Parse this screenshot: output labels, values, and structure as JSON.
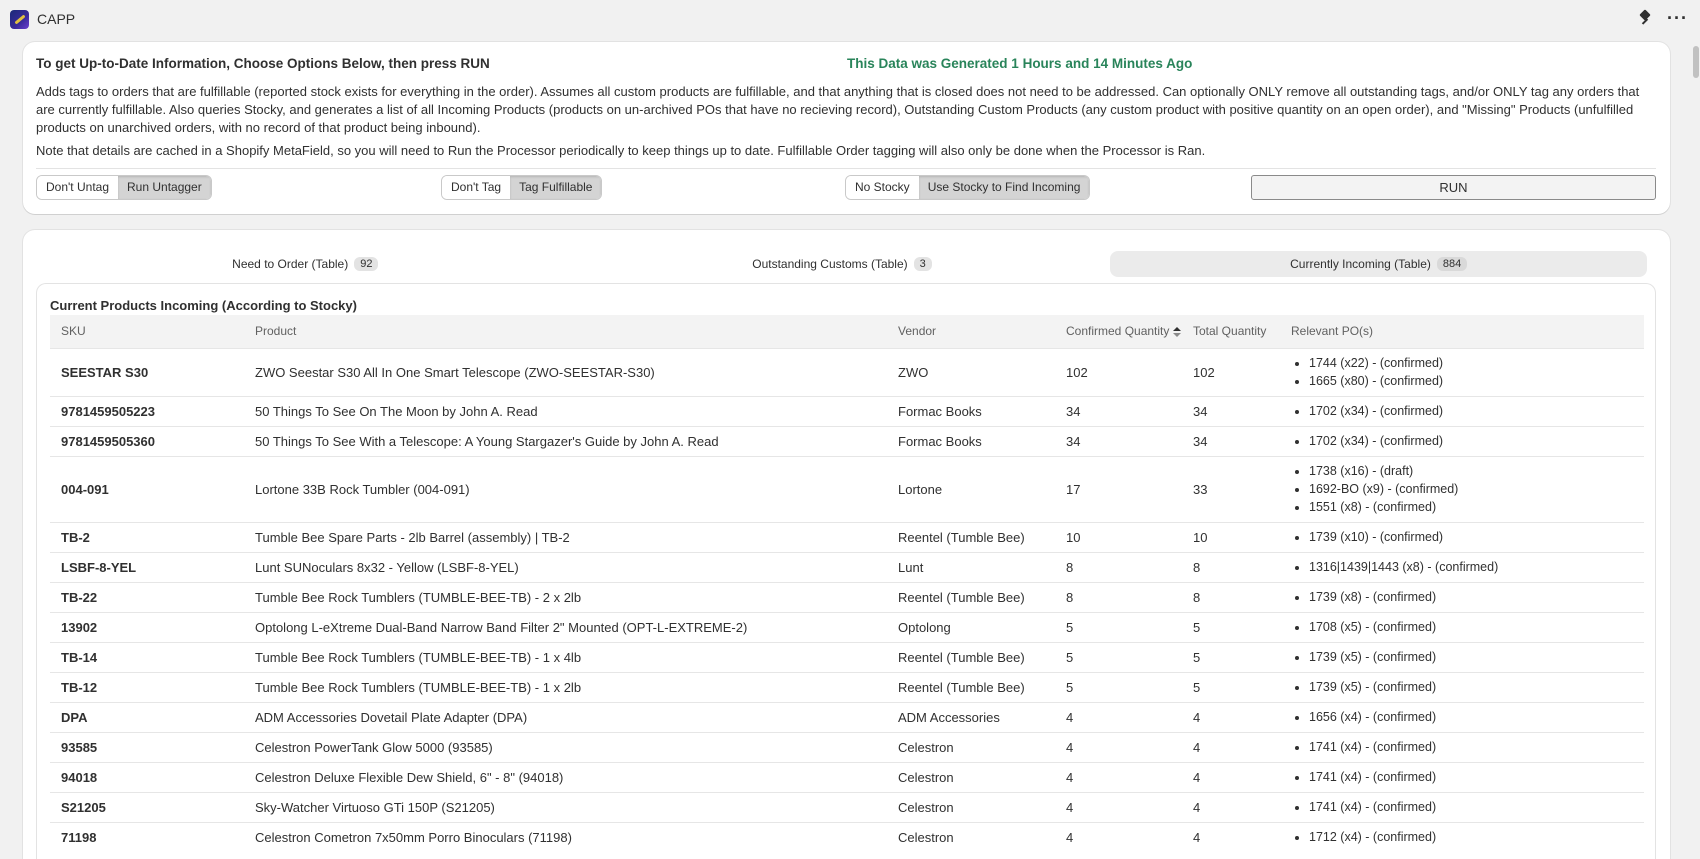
{
  "app": {
    "title": "CAPP"
  },
  "options": {
    "heading": "To get Up-to-Date Information, Choose Options Below, then press RUN",
    "generated": "This Data was Generated 1 Hours and 14 Minutes Ago",
    "description": "Adds tags to orders that are fulfillable (reported stock exists for everything in the order). Assumes all custom products are fulfillable, and that anything that is closed does not need to be addressed. Can optionally ONLY remove all outstanding tags, and/or ONLY tag any orders that are currently fulfillable. Also queries Stocky, and generates a list of all Incoming Products (products on un-archived POs that have no recieving record), Outstanding Custom Products (any custom product with positive quantity on an open order), and \"Missing\" Products (unfulfilled products on unarchived orders, with no record of that product being inbound).",
    "note": "Note that details are cached in a Shopify MetaField, so you will need to Run the Processor periodically to keep things up to date. Fulfillable Order tagging will also only be done when the Processor is Ran.",
    "untag": {
      "off": "Don't Untag",
      "on": "Run Untagger"
    },
    "tag": {
      "off": "Don't Tag",
      "on": "Tag Fulfillable"
    },
    "stocky": {
      "off": "No Stocky",
      "on": "Use Stocky to Find Incoming"
    },
    "run_label": "RUN"
  },
  "tabs": [
    {
      "label": "Need to Order (Table)",
      "count": "92"
    },
    {
      "label": "Outstanding Customs (Table)",
      "count": "3"
    },
    {
      "label": "Currently Incoming (Table)",
      "count": "884"
    }
  ],
  "table": {
    "title": "Current Products Incoming (According to Stocky)",
    "columns": [
      "SKU",
      "Product",
      "Vendor",
      "Confirmed Quantity",
      "Total Quantity",
      "Relevant PO(s)"
    ],
    "rows": [
      {
        "sku": "SEESTAR S30",
        "product": "ZWO Seestar S30 All In One Smart Telescope (ZWO-SEESTAR-S30)",
        "vendor": "ZWO",
        "confirmed": "102",
        "total": "102",
        "pos": [
          "1744 (x22) - (confirmed)",
          "1665 (x80) - (confirmed)"
        ]
      },
      {
        "sku": "9781459505223",
        "product": "50 Things To See On The Moon by John A. Read",
        "vendor": "Formac Books",
        "confirmed": "34",
        "total": "34",
        "pos": [
          "1702 (x34) - (confirmed)"
        ]
      },
      {
        "sku": "9781459505360",
        "product": "50 Things To See With a Telescope: A Young Stargazer's Guide by John A. Read",
        "vendor": "Formac Books",
        "confirmed": "34",
        "total": "34",
        "pos": [
          "1702 (x34) - (confirmed)"
        ]
      },
      {
        "sku": "004-091",
        "product": "Lortone 33B Rock Tumbler (004-091)",
        "vendor": "Lortone",
        "confirmed": "17",
        "total": "33",
        "pos": [
          "1738 (x16) - (draft)",
          "1692-BO (x9) - (confirmed)",
          "1551 (x8) - (confirmed)"
        ]
      },
      {
        "sku": "TB-2",
        "product": "Tumble Bee Spare Parts - 2lb Barrel (assembly) | TB-2",
        "vendor": "Reentel (Tumble Bee)",
        "confirmed": "10",
        "total": "10",
        "pos": [
          "1739 (x10) - (confirmed)"
        ]
      },
      {
        "sku": "LSBF-8-YEL",
        "product": "Lunt SUNoculars 8x32 - Yellow (LSBF-8-YEL)",
        "vendor": "Lunt",
        "confirmed": "8",
        "total": "8",
        "pos": [
          "1316|1439|1443 (x8) - (confirmed)"
        ]
      },
      {
        "sku": "TB-22",
        "product": "Tumble Bee Rock Tumblers (TUMBLE-BEE-TB) - 2 x 2lb",
        "vendor": "Reentel (Tumble Bee)",
        "confirmed": "8",
        "total": "8",
        "pos": [
          "1739 (x8) - (confirmed)"
        ]
      },
      {
        "sku": "13902",
        "product": "Optolong L-eXtreme Dual-Band Narrow Band Filter 2\" Mounted (OPT-L-EXTREME-2)",
        "vendor": "Optolong",
        "confirmed": "5",
        "total": "5",
        "pos": [
          "1708 (x5) - (confirmed)"
        ]
      },
      {
        "sku": "TB-14",
        "product": "Tumble Bee Rock Tumblers (TUMBLE-BEE-TB) - 1 x 4lb",
        "vendor": "Reentel (Tumble Bee)",
        "confirmed": "5",
        "total": "5",
        "pos": [
          "1739 (x5) - (confirmed)"
        ]
      },
      {
        "sku": "TB-12",
        "product": "Tumble Bee Rock Tumblers (TUMBLE-BEE-TB) - 1 x 2lb",
        "vendor": "Reentel (Tumble Bee)",
        "confirmed": "5",
        "total": "5",
        "pos": [
          "1739 (x5) - (confirmed)"
        ]
      },
      {
        "sku": "DPA",
        "product": "ADM Accessories Dovetail Plate Adapter (DPA)",
        "vendor": "ADM Accessories",
        "confirmed": "4",
        "total": "4",
        "pos": [
          "1656 (x4) - (confirmed)"
        ]
      },
      {
        "sku": "93585",
        "product": "Celestron PowerTank Glow 5000 (93585)",
        "vendor": "Celestron",
        "confirmed": "4",
        "total": "4",
        "pos": [
          "1741 (x4) - (confirmed)"
        ]
      },
      {
        "sku": "94018",
        "product": "Celestron Deluxe Flexible Dew Shield, 6\" - 8\" (94018)",
        "vendor": "Celestron",
        "confirmed": "4",
        "total": "4",
        "pos": [
          "1741 (x4) - (confirmed)"
        ]
      },
      {
        "sku": "S21205",
        "product": "Sky-Watcher Virtuoso GTi 150P (S21205)",
        "vendor": "Celestron",
        "confirmed": "4",
        "total": "4",
        "pos": [
          "1741 (x4) - (confirmed)"
        ]
      },
      {
        "sku": "71198",
        "product": "Celestron Cometron 7x50mm Porro Binoculars (71198)",
        "vendor": "Celestron",
        "confirmed": "4",
        "total": "4",
        "pos": [
          "1712 (x4) - (confirmed)"
        ]
      }
    ]
  }
}
